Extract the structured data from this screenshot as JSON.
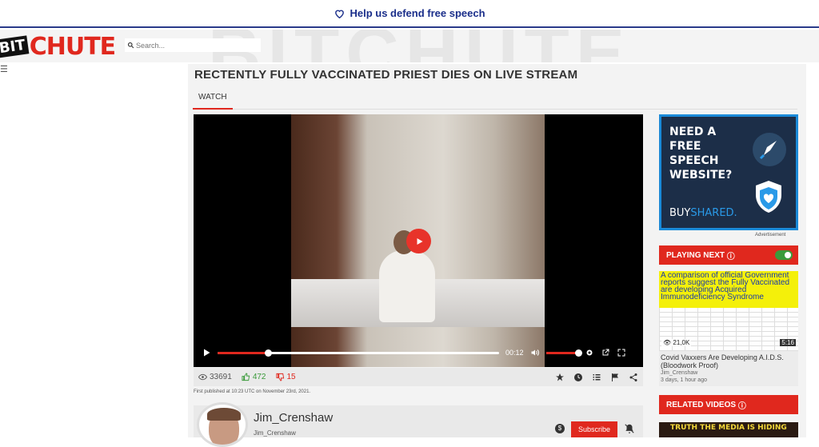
{
  "banner": {
    "text": "Help us defend free speech"
  },
  "header": {
    "logo_bit": "BIT",
    "logo_chute": "CHUTE",
    "search_placeholder": "Search..."
  },
  "video": {
    "title": "RECTENTLY FULLY VACCINATED PRIEST DIES ON LIVE STREAM",
    "tab": "WATCH",
    "time": "00:12",
    "progress": 0.18,
    "volume": 1.0,
    "views": "33691",
    "likes": "472",
    "dislikes": "15",
    "published": "First published at 10:23 UTC on November 23rd, 2021."
  },
  "channel": {
    "name": "Jim_Crenshaw",
    "handle": "Jim_Crenshaw",
    "tip": "$",
    "subscribe_label": "Subscribe"
  },
  "ad": {
    "lines": [
      "NEED A",
      "FREE",
      "SPEECH",
      "WEBSITE?"
    ],
    "brand_1": "BUY",
    "brand_2": "SHARED.",
    "label": "Advertisement"
  },
  "playing_next": {
    "header": "PLAYING NEXT",
    "thumb_text": "A comparison of official Government reports suggest the Fully Vaccinated are developing Acquired Immunodeficiency Syndrome",
    "views": "21,0K",
    "duration": "5:16",
    "title": "Covid Vaxxers Are Developing A.I.D.S. (Bloodwork Proof)",
    "channel": "Jim_Crenshaw",
    "time": "3 days, 1 hour ago"
  },
  "related": {
    "header": "RELATED VIDEOS",
    "thumb_text": "TRUTH THE MEDIA IS HIDING"
  },
  "colors": {
    "brand_red": "#e0281e",
    "banner_blue": "#1a2e8a"
  }
}
